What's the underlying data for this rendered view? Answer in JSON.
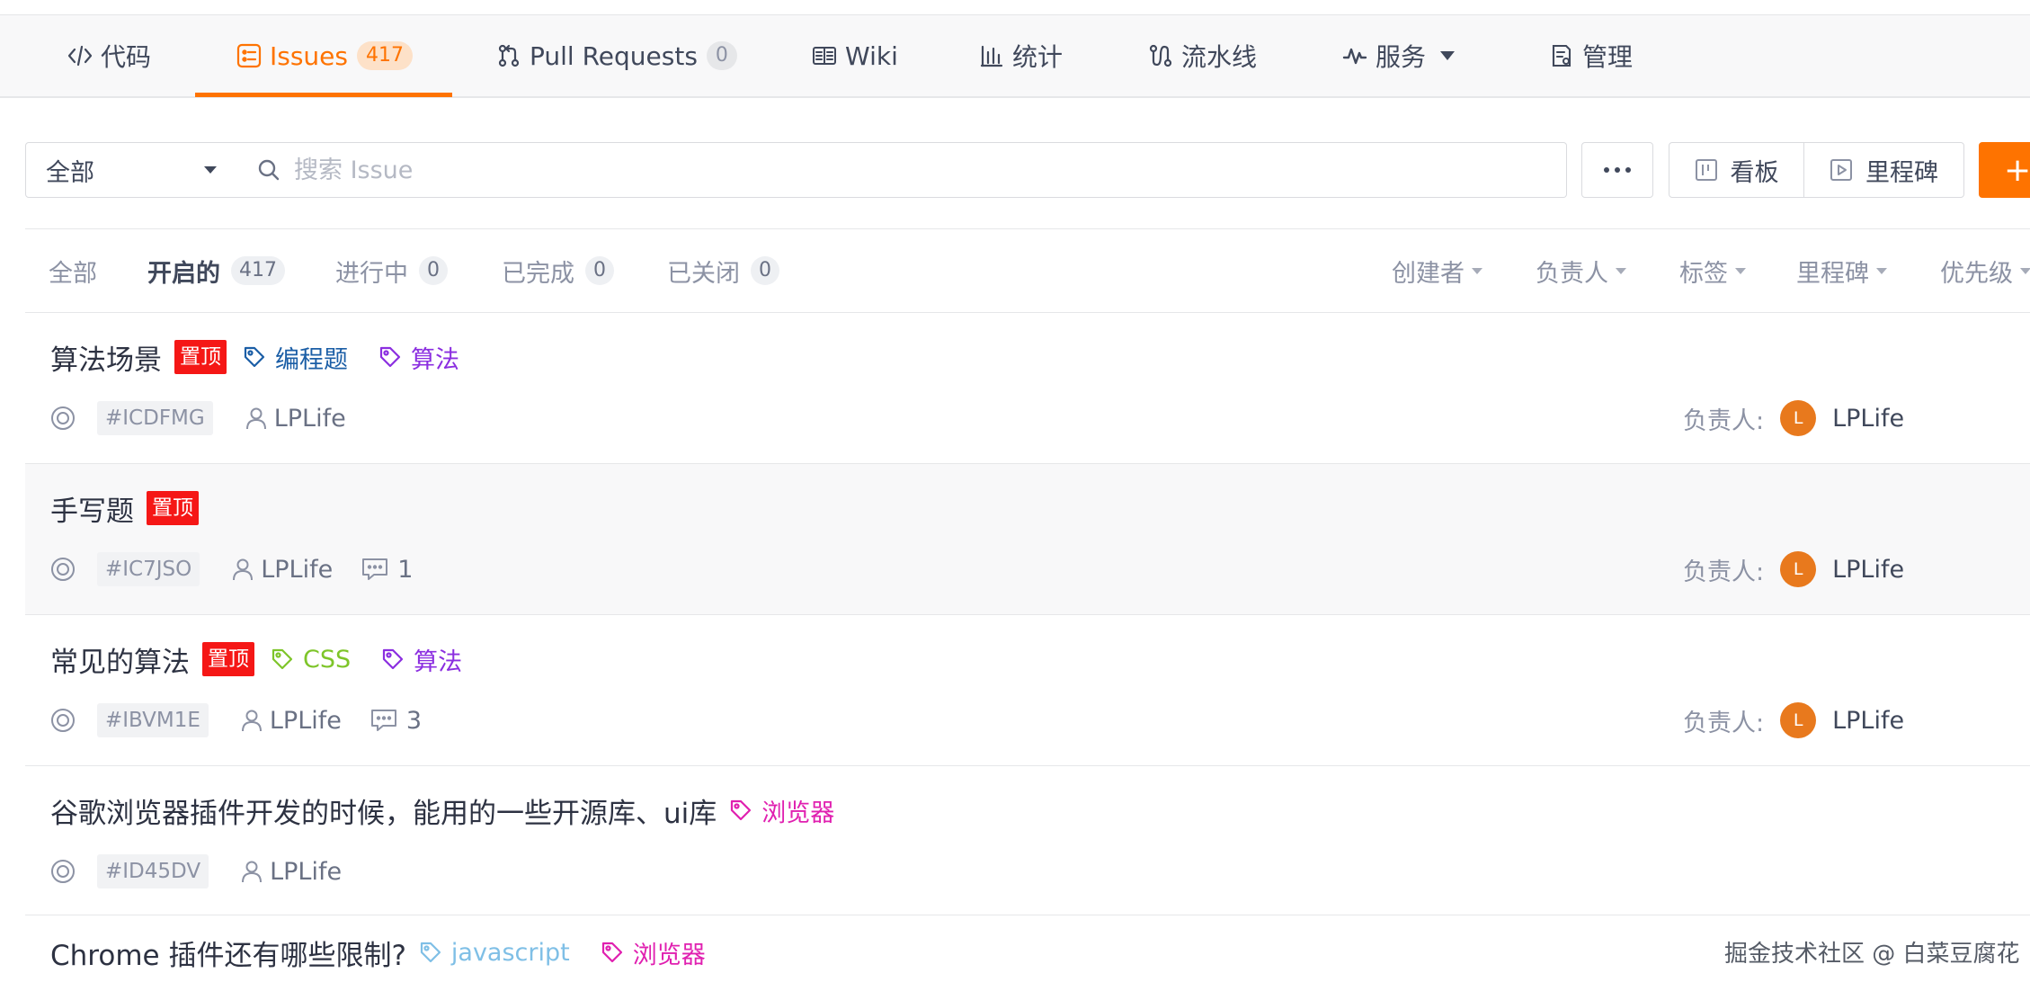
{
  "nav": {
    "tabs": [
      {
        "label": "代码",
        "icon": "code-icon"
      },
      {
        "label": "Issues",
        "count": "417",
        "icon": "issues-icon",
        "active": true
      },
      {
        "label": "Pull Requests",
        "count": "0",
        "icon": "pull-request-icon"
      },
      {
        "label": "Wiki",
        "icon": "book-icon"
      },
      {
        "label": "统计",
        "icon": "bar-chart-icon"
      },
      {
        "label": "流水线",
        "icon": "pipeline-icon"
      },
      {
        "label": "服务",
        "icon": "pulse-icon"
      },
      {
        "label": "管理",
        "icon": "manage-icon"
      }
    ]
  },
  "toolbar": {
    "scope_value": "全部",
    "search_placeholder": "搜索 Issue",
    "kanban_label": "看板",
    "milestone_label": "里程碑",
    "new_label": "+"
  },
  "filters": {
    "states": [
      {
        "label": "全部"
      },
      {
        "label": "开启的",
        "count": "417",
        "active": true
      },
      {
        "label": "进行中",
        "count": "0"
      },
      {
        "label": "已完成",
        "count": "0"
      },
      {
        "label": "已关闭",
        "count": "0"
      }
    ],
    "dropdowns": [
      "创建者",
      "负责人",
      "标签",
      "里程碑",
      "优先级"
    ]
  },
  "colors": {
    "accent": "#fe7300",
    "pin": "#f51716",
    "tag_programming": "#1b5ea6",
    "tag_algorithm": "#8b2ee0",
    "tag_css": "#7ec52a",
    "tag_browser": "#e020b0",
    "tag_javascript": "#7fbfe6"
  },
  "issues": [
    {
      "title": "算法场景",
      "pin": "置顶",
      "tags": [
        {
          "label": "编程题",
          "color": "#1b5ea6"
        },
        {
          "label": "算法",
          "color": "#8b2ee0"
        }
      ],
      "id": "#ICDFMG",
      "author": "LPLife",
      "assignee_label": "负责人:",
      "assignee_initial": "L",
      "assignee": "LPLife"
    },
    {
      "title": "手写题",
      "pin": "置顶",
      "tags": [],
      "id": "#IC7JSO",
      "author": "LPLife",
      "comments": "1",
      "assignee_label": "负责人:",
      "assignee_initial": "L",
      "assignee": "LPLife"
    },
    {
      "title": "常见的算法",
      "pin": "置顶",
      "tags": [
        {
          "label": "CSS",
          "color": "#7ec52a"
        },
        {
          "label": "算法",
          "color": "#8b2ee0"
        }
      ],
      "id": "#IBVM1E",
      "author": "LPLife",
      "comments": "3",
      "assignee_label": "负责人:",
      "assignee_initial": "L",
      "assignee": "LPLife"
    },
    {
      "title": "谷歌浏览器插件开发的时候，能用的一些开源库、ui库",
      "tags": [
        {
          "label": "浏览器",
          "color": "#e020b0"
        }
      ],
      "id": "#ID45DV",
      "author": "LPLife"
    },
    {
      "title": "Chrome 插件还有哪些限制?",
      "tags": [
        {
          "label": "javascript",
          "color": "#7fbfe6"
        },
        {
          "label": "浏览器",
          "color": "#e020b0"
        }
      ]
    }
  ],
  "watermark": "掘金技术社区 @ 白菜豆腐花"
}
